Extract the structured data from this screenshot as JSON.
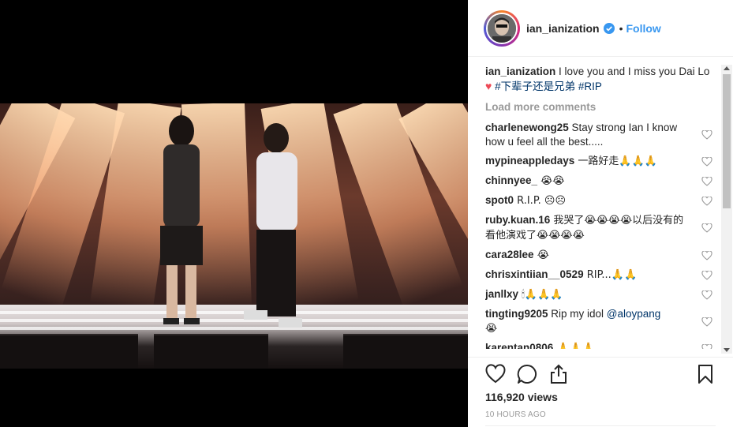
{
  "header": {
    "username": "ian_ianization",
    "separator": "•",
    "follow_label": "Follow"
  },
  "caption": {
    "username": "ian_ianization",
    "text": " I love you and I miss you Dai Lo ",
    "heart": "♥",
    "hashtag1": "#下辈子还是兄弟",
    "hashtag2": "#RIP"
  },
  "load_more": "Load more comments",
  "comments": [
    {
      "user": "charlenewong25",
      "text": " Stay strong Ian I know how u feel all the best....."
    },
    {
      "user": "mypineappledays",
      "text": " 一路好走🙏🙏🙏"
    },
    {
      "user": "chinnyee_",
      "text": " 😭😭"
    },
    {
      "user": "spot0",
      "text": " R.I.P. ☹☹"
    },
    {
      "user": "ruby.kuan.16",
      "text": " 我哭了😭😭😭😭以后没有的看他演戏了😭😭😭😭"
    },
    {
      "user": "cara28lee",
      "text": " 😭"
    },
    {
      "user": "chrisxintiian__0529",
      "text": " RIP...🙏🙏"
    },
    {
      "user": "janllxy",
      "text": " 🕯🙏🙏🙏"
    },
    {
      "user": "tingting9205",
      "text": " Rip my idol ",
      "mention": "@aloypang",
      "after": "😭"
    },
    {
      "user": "karentan0806",
      "text": " 🙏🙏🙏"
    }
  ],
  "stats": {
    "views": "116,920 views",
    "time": "10 HOURS AGO"
  },
  "colors": {
    "link_blue": "#3897f0",
    "hashtag": "#003569",
    "heart_red": "#ed4956",
    "muted": "#999999"
  },
  "icons": [
    "verified-badge-icon",
    "heart-outline-icon",
    "comment-icon",
    "share-icon",
    "bookmark-icon"
  ]
}
